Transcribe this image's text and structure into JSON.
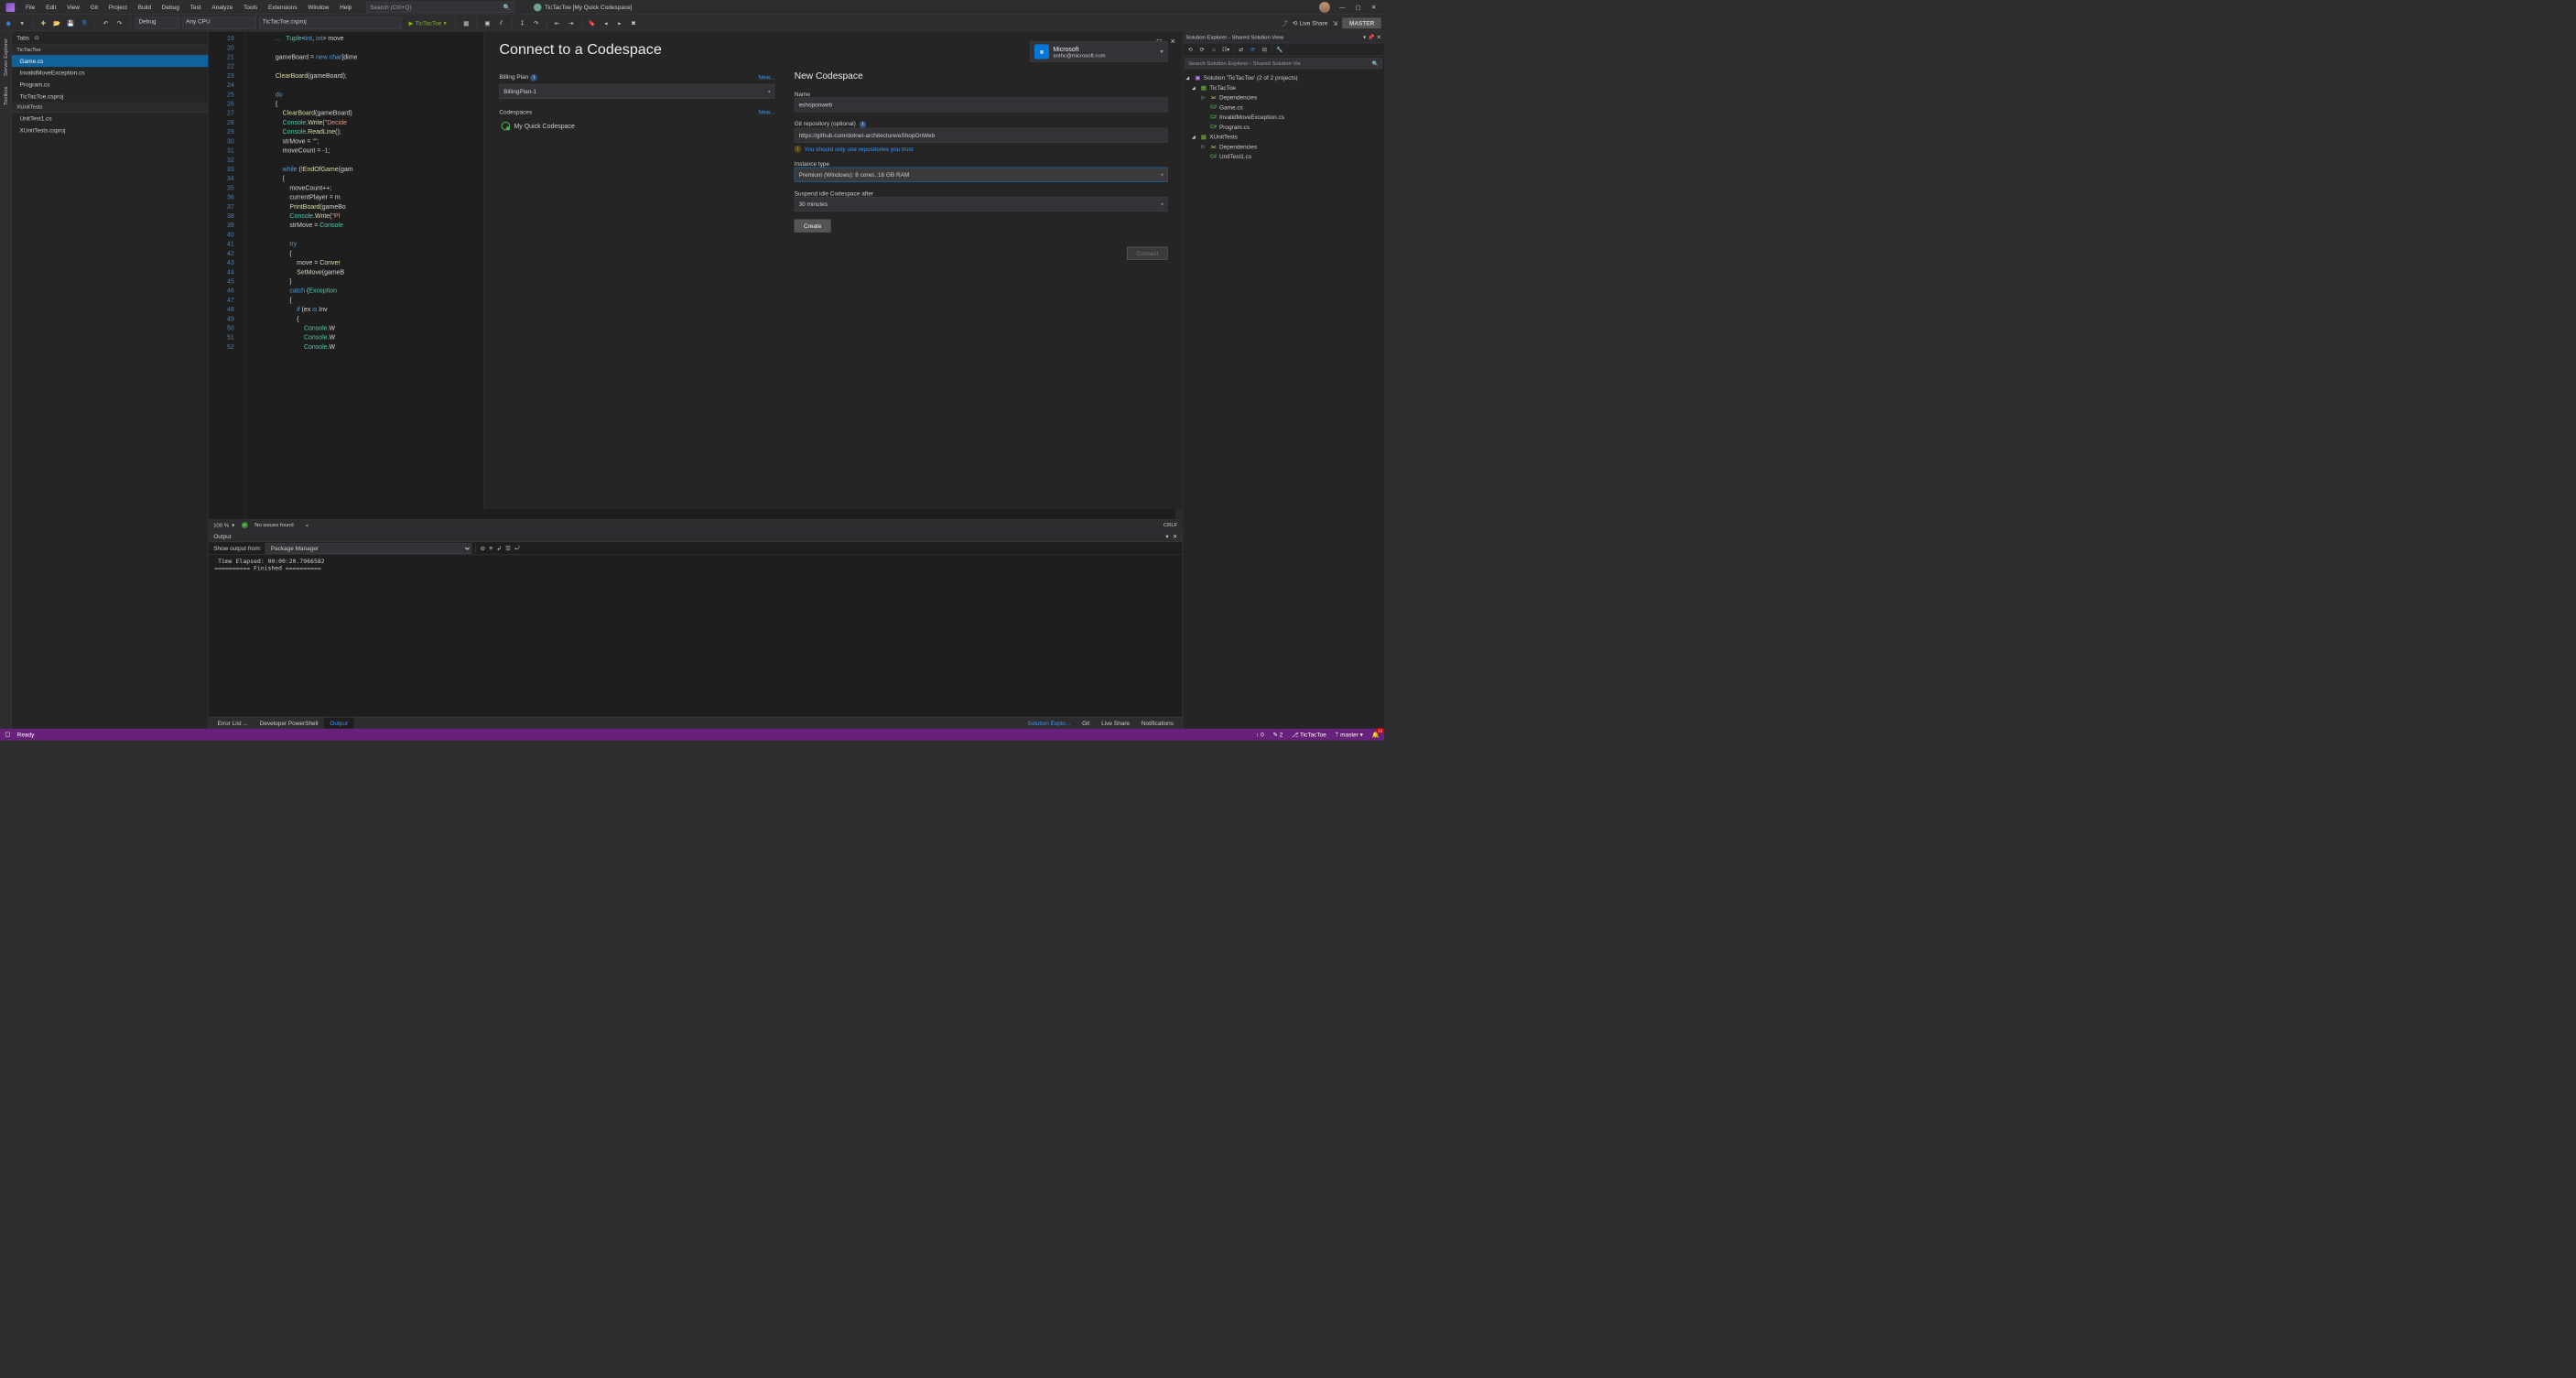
{
  "title": {
    "app": "TicTacToe [My Quick Codespace]"
  },
  "menu": [
    "File",
    "Edit",
    "View",
    "Git",
    "Project",
    "Build",
    "Debug",
    "Test",
    "Analyze",
    "Tools",
    "Extensions",
    "Window",
    "Help"
  ],
  "search_placeholder": "Search (Ctrl+Q)",
  "toolbar": {
    "config": "Debug",
    "platform": "Any CPU",
    "startup": "TicTacToe.csproj",
    "run": "TicTacToe",
    "liveshare": "Live Share",
    "master": "MASTER"
  },
  "leftrail": [
    "Server Explorer",
    "Toolbox"
  ],
  "tabs": {
    "title": "Tabs",
    "groups": [
      {
        "name": "TicTacToe",
        "items": [
          "Game.cs",
          "InvalidMoveException.cs",
          "Program.cs",
          "TicTacToe.csproj"
        ],
        "active": "Game.cs"
      },
      {
        "name": "XUnitTests",
        "items": [
          "UnitTest1.cs",
          "XUnitTests.csproj"
        ]
      }
    ]
  },
  "editor": {
    "first_line": 19,
    "lines": [
      "...   Tuple<int, int> move",
      "",
      "gameBoard = new char[dime",
      "",
      "ClearBoard(gameBoard);",
      "",
      "do",
      "{",
      "    ClearBoard(gameBoard)",
      "    Console.Write(\"Decide",
      "    Console.ReadLine();",
      "    strMove = \"\";",
      "    moveCount = -1;",
      "",
      "    while (!EndOfGame(gam",
      "    {",
      "        moveCount++;",
      "        currentPlayer = m",
      "        PrintBoard(gameBo",
      "        Console.Write(\"Pl",
      "        strMove = Console",
      "",
      "        try",
      "        {",
      "            move = Conver",
      "            SetMove(gameB",
      "        }",
      "        catch (Exception ",
      "        {",
      "            if (ex is Inv",
      "            {",
      "                Console.W",
      "                Console.W",
      "                Console.W"
    ],
    "zoom": "100 %",
    "issues": "No issues found",
    "encoding": "CRLF"
  },
  "dialog": {
    "title": "Connect to a Codespace",
    "account": {
      "name": "Microsoft",
      "email": "anthc@microsoft.com"
    },
    "billing_label": "Billing Plan",
    "billing_value": "BillingPlan-1",
    "new_link": "New...",
    "codespaces_label": "Codespaces",
    "codespace_item": "My Quick Codespace",
    "new_title": "New Codespace",
    "name_label": "Name",
    "name_value": "eshoponweb",
    "git_label": "Git repository (optional)",
    "git_value": "https://github.com/dotnet-architecture/eShopOnWeb",
    "git_warning": "You should only use repositories you trust",
    "instance_label": "Instance type",
    "instance_value": "Premium (Windows): 8 cores, 16 GB RAM",
    "suspend_label": "Suspend idle Codespace after",
    "suspend_value": "30 minutes",
    "create": "Create",
    "connect": "Connect"
  },
  "solexp": {
    "title": "Solution Explorer - Shared Solution View",
    "search_placeholder": "Search Solution Explorer - Shared Solution Vie",
    "root": "Solution 'TicTacToe' (2 of 2 projects)",
    "projects": [
      {
        "name": "TicTacToe",
        "children": [
          "Dependencies",
          "Game.cs",
          "InvalidMoveException.cs",
          "Program.cs"
        ]
      },
      {
        "name": "XUnitTests",
        "children": [
          "Dependencies",
          "UnitTest1.cs"
        ]
      }
    ]
  },
  "output": {
    "title": "Output",
    "show_from_label": "Show output from:",
    "show_from_value": "Package Manager",
    "body": " Time Elapsed: 00:00:20.7966582\n========== Finished =========="
  },
  "bottom_tabs": {
    "left": [
      "Error List ...",
      "Developer PowerShell",
      "Output"
    ],
    "active_left": "Output",
    "right": [
      "Solution Explo...",
      "Git",
      "Live Share",
      "Notifications"
    ],
    "active_right": "Solution Explo..."
  },
  "status": {
    "ready": "Ready",
    "up": "0",
    "pencil": "2",
    "repo": "TicTacToe",
    "branch": "master",
    "bell": "12"
  }
}
